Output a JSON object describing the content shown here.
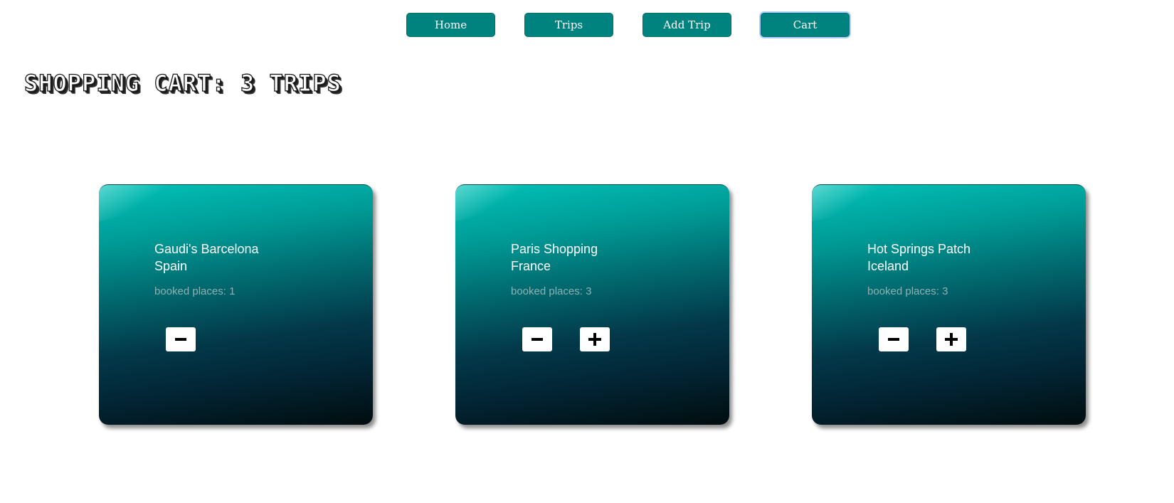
{
  "nav": {
    "items": [
      {
        "label": "Home"
      },
      {
        "label": "Trips"
      },
      {
        "label": "Add Trip"
      },
      {
        "label": "Cart",
        "active": true
      }
    ]
  },
  "page": {
    "title": "Shopping Cart: 3 trips"
  },
  "cart": {
    "trips": [
      {
        "name": "Gaudi's Barcelona",
        "country": "Spain",
        "booked": "booked places: 1",
        "can_decrease": true,
        "can_increase": false
      },
      {
        "name": "Paris Shopping",
        "country": "France",
        "booked": "booked places: 3",
        "can_decrease": true,
        "can_increase": true
      },
      {
        "name": "Hot Springs Patch",
        "country": "Iceland",
        "booked": "booked places: 3",
        "can_decrease": true,
        "can_increase": true
      }
    ]
  },
  "icons": {
    "decrease": "minus-icon",
    "increase": "plus-icon"
  },
  "colors": {
    "nav_button": "#00827f",
    "card_top": "#00c2b8",
    "card_bottom": "#010d0f",
    "booked_text": "#8fb0b0"
  }
}
